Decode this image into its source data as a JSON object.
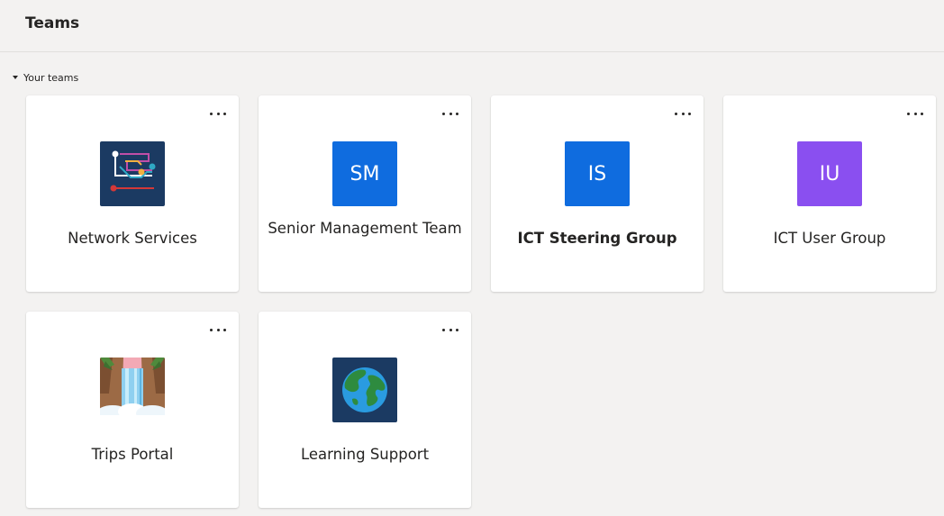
{
  "header": {
    "title": "Teams"
  },
  "section": {
    "label": "Your teams"
  },
  "more_label": "More options",
  "teams": [
    {
      "name": "Network Services",
      "initials": "",
      "color": "#1b3a62",
      "icon": "circuit-icon",
      "bold": false
    },
    {
      "name": "Senior Management Team",
      "initials": "SM",
      "color": "#0f6cdf",
      "icon": "",
      "bold": false
    },
    {
      "name": "ICT Steering Group",
      "initials": "IS",
      "color": "#0f6cdf",
      "icon": "",
      "bold": true
    },
    {
      "name": "ICT User Group",
      "initials": "IU",
      "color": "#8a4ff0",
      "icon": "",
      "bold": false
    },
    {
      "name": "Trips Portal",
      "initials": "",
      "color": "#b98a5f",
      "icon": "waterfall-icon",
      "bold": false
    },
    {
      "name": "Learning Support",
      "initials": "",
      "color": "#1b3a62",
      "icon": "globe-icon",
      "bold": false
    }
  ]
}
